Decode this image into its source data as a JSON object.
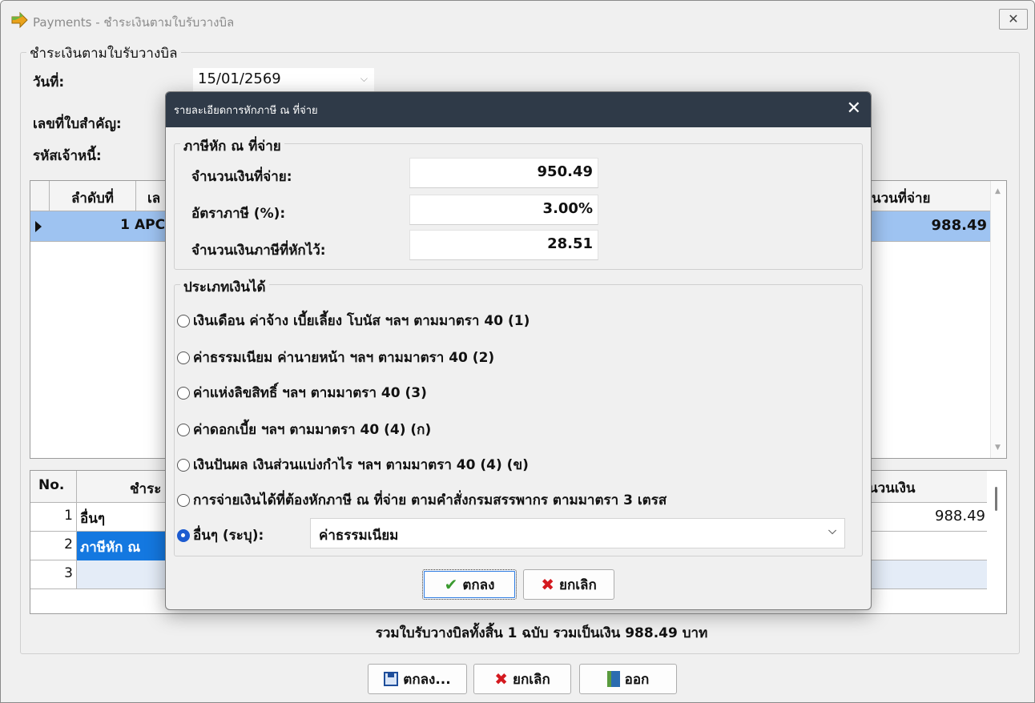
{
  "window": {
    "title": "Payments - ชำระเงินตามใบรับวางบิล",
    "close_label": "✕"
  },
  "form": {
    "group_caption": "ชำระเงินตามใบรับวางบิล",
    "date_label": "วันที่:",
    "date_value": "15/01/2569",
    "doc_no_label": "เลขที่ใบสำคัญ:",
    "creditor_label": "รหัสเจ้าหนี้:"
  },
  "grid1": {
    "headers": {
      "seq": "ลำดับที่",
      "no_partial": "เล",
      "paid_partial": "นวนที่จ่าย"
    },
    "rows": [
      {
        "seq": "1",
        "code_partial": "APC",
        "amount": "988.49"
      }
    ]
  },
  "grid2": {
    "headers": {
      "no": "No.",
      "pay_partial": "ชำระ",
      "amount_partial": "นวนเงิน"
    },
    "rows": [
      {
        "no": "1",
        "label": "อื่นๆ",
        "amount": "988.49"
      },
      {
        "no": "2",
        "label": "ภาษีหัก ณ",
        "amount": ""
      },
      {
        "no": "3",
        "label": "",
        "amount": ""
      }
    ]
  },
  "summary": "รวมใบรับวางบิลทั้งสิ้น 1 ฉบับ รวมเป็นเงิน 988.49 บาท",
  "buttons": {
    "ok": "ตกลง...",
    "cancel": "ยกเลิก",
    "exit": "ออก"
  },
  "dialog": {
    "title": "รายละเอียดการหักภาษี ณ ที่จ่าย",
    "close_label": "✕",
    "tax_group_caption": "ภาษีหัก ณ ที่จ่าย",
    "paid_amount_label": "จำนวนเงินที่จ่าย:",
    "paid_amount_value": "950.49",
    "tax_rate_label": "อัตราภาษี (%):",
    "tax_rate_value": "3.00%",
    "tax_amount_label": "จำนวนเงินภาษีที่หักไว้:",
    "tax_amount_value": "28.51",
    "income_group_caption": "ประเภทเงินได้",
    "income_types": [
      "เงินเดือน ค่าจ้าง เบี้ยเลี้ยง โบนัส ฯลฯ ตามมาตรา 40 (1)",
      "ค่าธรรมเนียม ค่านายหน้า ฯลฯ ตามมาตรา 40 (2)",
      "ค่าแห่งลิขสิทธิ์ ฯลฯ ตามมาตรา 40 (3)",
      "ค่าดอกเบี้ย ฯลฯ ตามมาตรา 40 (4) (ก)",
      "เงินปันผล เงินส่วนแบ่งกำไร ฯลฯ ตามมาตรา 40 (4) (ข)",
      "การจ่ายเงินได้ที่ต้องหักภาษี ณ ที่จ่าย ตามคำสั่งกรมสรรพากร ตามมาตรา 3 เตรส"
    ],
    "other_label": "อื่นๆ (ระบุ):",
    "other_value": "ค่าธรรมเนียม",
    "ok_label": "ตกลง",
    "cancel_label": "ยกเลิก"
  },
  "colors": {
    "selection": "#9ec3f1",
    "dialog_titlebar": "#2f3a48",
    "radio_checked": "#1c5bd0"
  }
}
